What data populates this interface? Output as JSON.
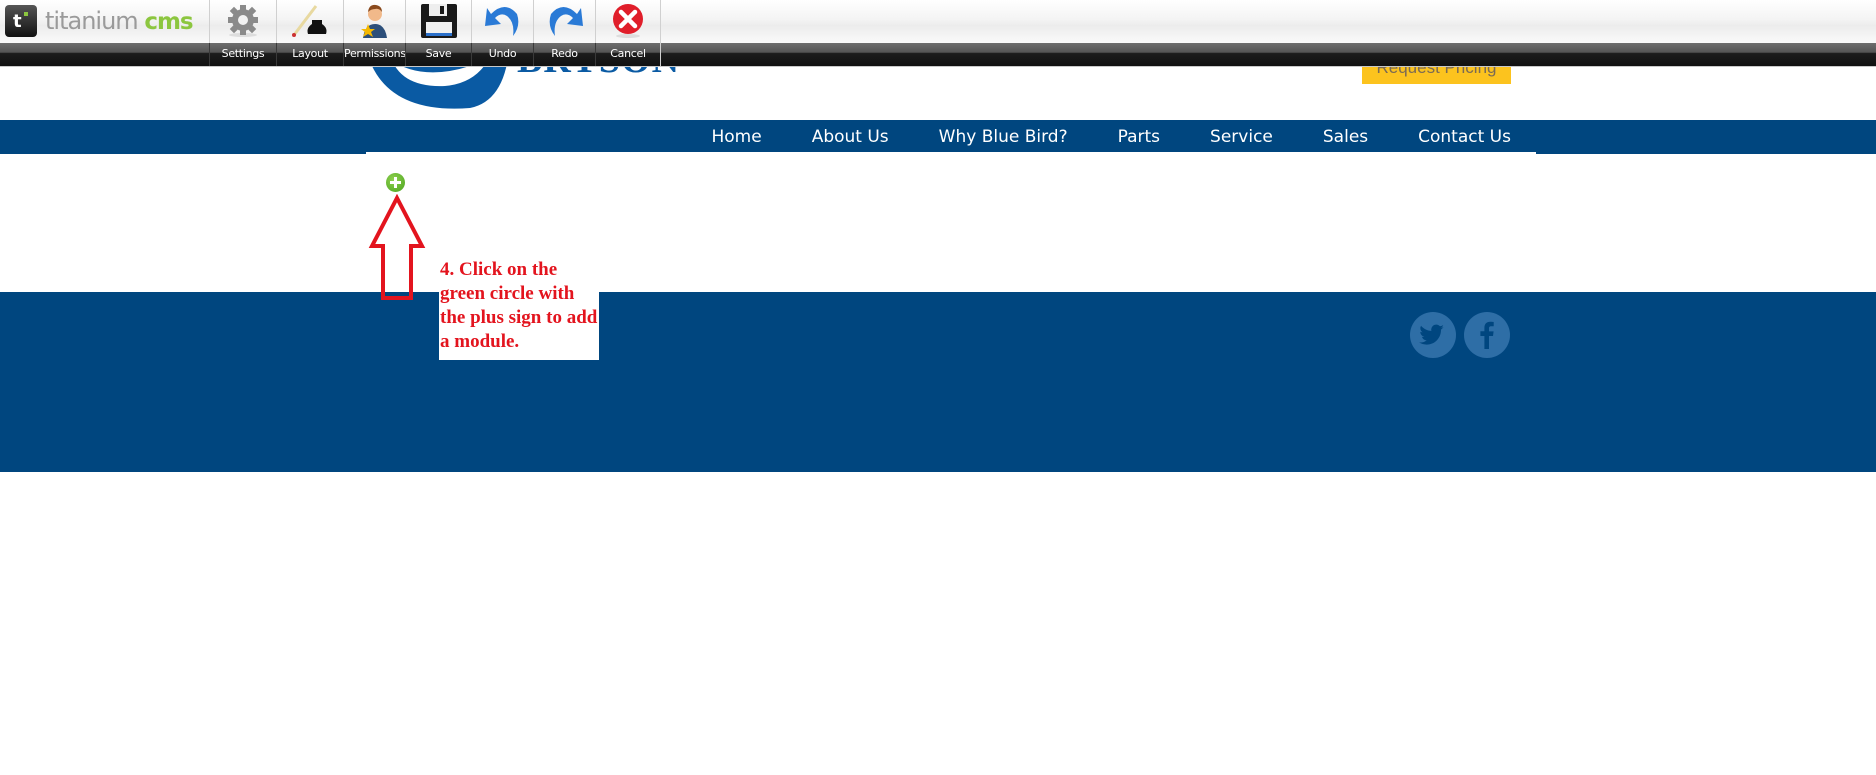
{
  "cms": {
    "brand": {
      "prefix": "titanium",
      "suffix": "cms",
      "logo_letter": "ti"
    },
    "toolbar": [
      {
        "id": "settings",
        "label": "Settings",
        "icon": "gear-icon"
      },
      {
        "id": "layout",
        "label": "Layout",
        "icon": "ink-pen-icon"
      },
      {
        "id": "permissions",
        "label": "Permissions",
        "icon": "user-star-icon"
      },
      {
        "id": "save",
        "label": "Save",
        "icon": "floppy-disk-icon"
      },
      {
        "id": "undo",
        "label": "Undo",
        "icon": "undo-arrow-icon"
      },
      {
        "id": "redo",
        "label": "Redo",
        "icon": "redo-arrow-icon"
      },
      {
        "id": "cancel",
        "label": "Cancel",
        "icon": "red-x-circle-icon"
      }
    ]
  },
  "site": {
    "logo_text": "BRYSON",
    "request_pricing": "Request Pricing",
    "nav": [
      "Home",
      "About Us",
      "Why Blue Bird?",
      "Parts",
      "Service",
      "Sales",
      "Contact Us"
    ],
    "social": [
      "twitter-icon",
      "facebook-icon"
    ]
  },
  "annotation": {
    "text": "4. Click on the green circle with the plus sign to add a module."
  },
  "colors": {
    "nav_blue": "#00467f",
    "pricing_yellow": "#fcc31e",
    "annotation_red": "#e3141e",
    "add_green": "#6cc23a"
  }
}
